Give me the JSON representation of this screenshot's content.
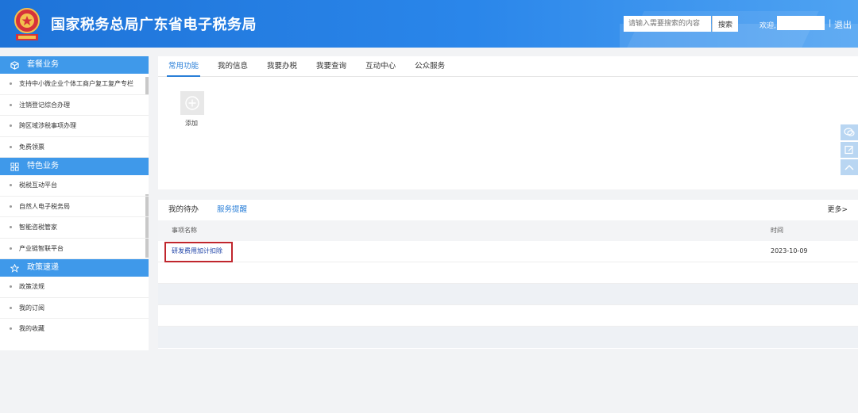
{
  "header": {
    "title": "国家税务总局广东省电子税务局",
    "search_placeholder": "请输入需要搜索的内容",
    "search_button": "搜索",
    "welcome": "欢迎,",
    "separator": "|",
    "logout": "退出",
    "accent_color": "#1e73d8"
  },
  "sidebar": {
    "sections": [
      {
        "title": "套餐业务",
        "icon": "cube-icon",
        "items": [
          "支持中小微企业个体工商户复工复产专栏",
          "注销登记综合办理",
          "跨区域涉税事项办理",
          "免费领票"
        ]
      },
      {
        "title": "特色业务",
        "icon": "grid-icon",
        "items": [
          "税税互动平台",
          "自然人电子税务局",
          "智能咨税管家",
          "产业链智联平台"
        ]
      },
      {
        "title": "政策速递",
        "icon": "star-icon",
        "items": [
          "政策法规",
          "我的订阅",
          "我的收藏"
        ]
      }
    ]
  },
  "main": {
    "tabs": [
      "常用功能",
      "我的信息",
      "我要办税",
      "我要查询",
      "互动中心",
      "公众服务"
    ],
    "active_tab": 0,
    "add_label": "添加",
    "bottom_tabs": [
      "我的待办",
      "服务提醒"
    ],
    "bottom_active": 1,
    "more_label": "更多>",
    "table": {
      "headers": [
        "事项名称",
        "时间"
      ],
      "rows": [
        {
          "name": "研发费用加计扣除",
          "time": "2023-10-09"
        }
      ]
    }
  }
}
